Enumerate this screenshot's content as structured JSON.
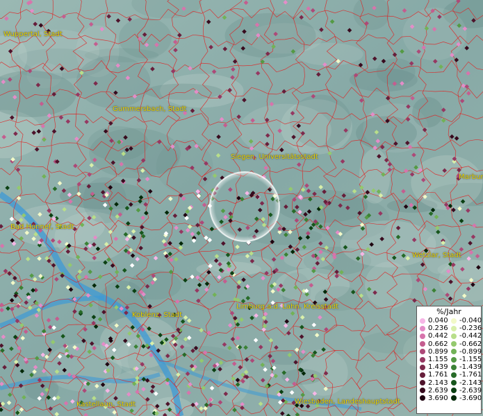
{
  "map": {
    "cities": [
      {
        "name": "Wuppertal, Stadt",
        "pos": [
          5,
          44
        ]
      },
      {
        "name": "Gummersbach, Stadt",
        "pos": [
          162,
          152
        ]
      },
      {
        "name": "Siegen, Universitätsstadt",
        "pos": [
          332,
          221
        ]
      },
      {
        "name": "Marburg",
        "pos": [
          660,
          250
        ]
      },
      {
        "name": "Bad Honnef, Stadt",
        "pos": [
          15,
          322
        ]
      },
      {
        "name": "Wetzlar, Stadt",
        "pos": [
          593,
          363
        ]
      },
      {
        "name": "Limburg a.d. Lahn, Kreisstadt",
        "pos": [
          340,
          437
        ]
      },
      {
        "name": "Koblenz, Stadt",
        "pos": [
          190,
          449
        ]
      },
      {
        "name": "Kastellaun, Stadt",
        "pos": [
          110,
          578
        ]
      },
      {
        "name": "Wiesbaden, Landeshauptstadt",
        "pos": [
          424,
          574
        ]
      }
    ],
    "colors": {
      "terrain": "#8fb0ad",
      "border": "#e02020",
      "river": "#3d9ad6",
      "label": "#e8d800"
    }
  },
  "legend": {
    "title": "%/Jahr",
    "positive": [
      {
        "label": "0.040",
        "color": "#f6b6e6"
      },
      {
        "label": "0.236",
        "color": "#e48cc8"
      },
      {
        "label": "0.442",
        "color": "#d774ac"
      },
      {
        "label": "0.662",
        "color": "#c45d8f"
      },
      {
        "label": "0.899",
        "color": "#ad4978"
      },
      {
        "label": "1.155",
        "color": "#963862"
      },
      {
        "label": "1.439",
        "color": "#7d2a4c"
      },
      {
        "label": "1.761",
        "color": "#661e3a"
      },
      {
        "label": "2.143",
        "color": "#4e132b"
      },
      {
        "label": "2.639",
        "color": "#380b1e"
      },
      {
        "label": "3.690",
        "color": "#1f0410"
      }
    ],
    "negative": [
      {
        "label": "-0.040",
        "color": "#f2f9c8"
      },
      {
        "label": "-0.236",
        "color": "#d8efaa"
      },
      {
        "label": "-0.442",
        "color": "#b8de8a"
      },
      {
        "label": "-0.662",
        "color": "#94c96e"
      },
      {
        "label": "-0.899",
        "color": "#72b257"
      },
      {
        "label": "-1.155",
        "color": "#549a44"
      },
      {
        "label": "-1.439",
        "color": "#3b8235"
      },
      {
        "label": "-1.761",
        "color": "#276b28"
      },
      {
        "label": "-2.143",
        "color": "#17561c"
      },
      {
        "label": "-2.639",
        "color": "#0b4012"
      },
      {
        "label": "-3.690",
        "color": "#032808"
      }
    ]
  }
}
